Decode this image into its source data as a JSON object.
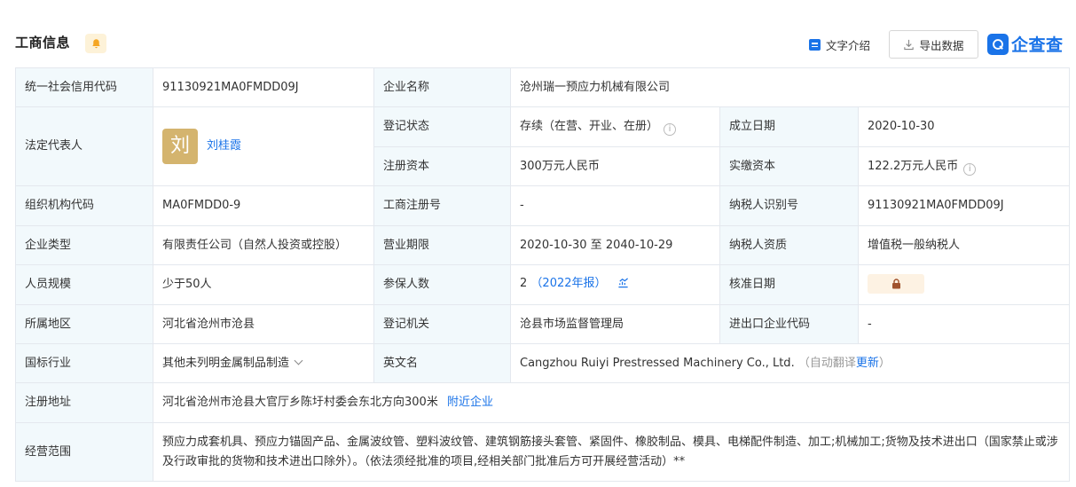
{
  "header": {
    "title": "工商信息",
    "intro_label": "文字介绍",
    "export_label": "导出数据",
    "logo_text": "企查查",
    "brand_color": "#1a73e8",
    "bell_color": "#f5a623"
  },
  "rows": {
    "credit_code": {
      "label": "统一社会信用代码",
      "value": "91130921MA0FMDD09J"
    },
    "company_name": {
      "label": "企业名称",
      "value": "沧州瑞一预应力机械有限公司"
    },
    "legal_rep": {
      "label": "法定代表人",
      "avatar": "刘",
      "name": "刘桂霞"
    },
    "reg_status": {
      "label": "登记状态",
      "value": "存续（在营、开业、在册）"
    },
    "founded": {
      "label": "成立日期",
      "value": "2020-10-30"
    },
    "reg_capital": {
      "label": "注册资本",
      "value": "300万元人民币"
    },
    "paid_capital": {
      "label": "实缴资本",
      "value": "122.2万元人民币"
    },
    "org_code": {
      "label": "组织机构代码",
      "value": "MA0FMDD0-9"
    },
    "reg_no": {
      "label": "工商注册号",
      "value": "-"
    },
    "taxpayer_id": {
      "label": "纳税人识别号",
      "value": "91130921MA0FMDD09J"
    },
    "company_type": {
      "label": "企业类型",
      "value": "有限责任公司（自然人投资或控股）"
    },
    "business_term": {
      "label": "营业期限",
      "value": "2020-10-30 至 2040-10-29"
    },
    "taxpayer_qual": {
      "label": "纳税人资质",
      "value": "增值税一般纳税人"
    },
    "staff_size": {
      "label": "人员规模",
      "value": "少于50人"
    },
    "insured": {
      "label": "参保人数",
      "value": "2",
      "report": "（2022年报）"
    },
    "approval_date": {
      "label": "核准日期"
    },
    "region": {
      "label": "所属地区",
      "value": "河北省沧州市沧县"
    },
    "reg_authority": {
      "label": "登记机关",
      "value": "沧县市场监督管理局"
    },
    "import_export": {
      "label": "进出口企业代码",
      "value": "-"
    },
    "industry": {
      "label": "国标行业",
      "value": "其他未列明金属制品制造"
    },
    "english_name": {
      "label": "英文名",
      "value": "Cangzhou Ruiyi Prestressed Machinery Co., Ltd.",
      "auto_note": "（自动翻译",
      "update_link": "更新",
      "close_paren": "）"
    },
    "address": {
      "label": "注册地址",
      "value": "河北省沧州市沧县大官厅乡陈圩村委会东北方向300米",
      "nearby_link": "附近企业"
    },
    "scope": {
      "label": "经营范围",
      "value": "预应力成套机具、预应力锚固产品、金属波纹管、塑料波纹管、建筑钢筋接头套管、紧固件、橡胶制品、模具、电梯配件制造、加工;机械加工;货物及技术进出口（国家禁止或涉及行政审批的货物和技术进出口除外）。（依法须经批准的项目,经相关部门批准后方可开展经营活动）**"
    }
  }
}
